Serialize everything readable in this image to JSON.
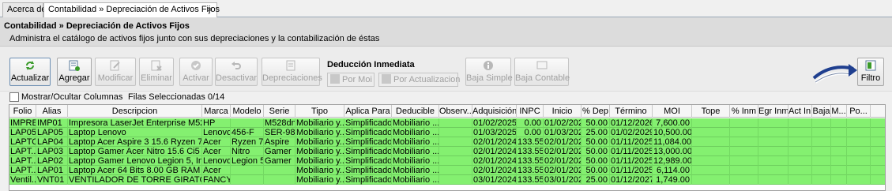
{
  "tabs": [
    {
      "label": "Acerca de"
    },
    {
      "label": "Contabilidad » Depreciación de Activos Fijos",
      "close": "×"
    }
  ],
  "header": {
    "title": "Contabilidad » Depreciación de Activos Fijos",
    "description": "Administra el catálogo de activos fijos junto con sus depreciaciones y la contabilización de éstas"
  },
  "toolbar": {
    "actualizar": "Actualizar",
    "agregar": "Agregar",
    "modificar": "Modificar",
    "eliminar": "Eliminar",
    "activar": "Activar",
    "desactivar": "Desactivar",
    "depreciaciones": "Depreciaciones",
    "deduccion_label": "Deducción Inmediata",
    "por_moi": "Por Moi",
    "por_actualizacion": "Por Actualizacion",
    "baja_simple": "Baja Simple",
    "baja_contable": "Baja Contable",
    "filtro": "Filtro"
  },
  "options": {
    "show_hide_columns": "Mostrar/Ocultar Columnas",
    "selected_rows": "Filas Seleccionadas  0/14"
  },
  "table": {
    "columns": [
      "Folio",
      "Alias",
      "Descripcion",
      "Marca",
      "Modelo",
      "Serie",
      "Tipo",
      "Aplica Para",
      "Deducible",
      "Observ...",
      "Adquisición",
      "INPC",
      "Inicio",
      "% Dep",
      "Término",
      "MOI",
      "Tope",
      "% Inm",
      "Egr Inm",
      "Act In...",
      "Baja",
      "M...",
      "Po..."
    ],
    "rows": [
      [
        "IMPRE...",
        "IMP01",
        "Impresora LaserJet Enterprise M528dn",
        "HP",
        "",
        "M528dn",
        "Mobiliario y...",
        "Simplificado...",
        "Mobiliario ...",
        "",
        "01/02/2025",
        "0.00",
        "01/02/2025",
        "50.00",
        "01/12/2026",
        "7,600.00",
        "",
        "",
        "",
        "",
        "",
        "",
        ""
      ],
      [
        "LAP05",
        "LAP05",
        "Laptop Lenovo",
        "Lenovo",
        "456-F",
        "SER-987",
        "Mobiliario y...",
        "Simplificado...",
        "Mobiliario ...",
        "",
        "01/03/2025",
        "0.00",
        "01/03/2025",
        "25.00",
        "01/02/2029",
        "10,500.00",
        "",
        "",
        "",
        "",
        "",
        "",
        ""
      ],
      [
        "LAPTOP",
        "LAP04",
        "Laptop Acer Aspire 3 15.6 Ryzen 7, 1...",
        "Acer",
        "Ryzen 7",
        "Aspire",
        "Mobiliario y...",
        "Simplificado...",
        "Mobiliario ...",
        "",
        "02/01/2024",
        "133.555",
        "02/01/2024",
        "50.00",
        "01/11/2025",
        "11,084.00",
        "",
        "",
        "",
        "",
        "",
        "",
        ""
      ],
      [
        "LAPT...",
        "LAP03",
        "Laptop Gamer Acer Nitro 15.6 Ci5 8g...",
        "Acer",
        "Nitro",
        "Gamer",
        "Mobiliario y...",
        "Simplificado...",
        "Mobiliario ...",
        "",
        "02/01/2024",
        "133.555",
        "02/01/2024",
        "50.00",
        "01/11/2025",
        "13,000.00",
        "",
        "",
        "",
        "",
        "",
        "",
        ""
      ],
      [
        "LAPT...",
        "LAP02",
        "Laptop Gamer Lenovo Legion 5, Inte...",
        "Lenovo",
        "Legion 5",
        "Gamer",
        "Mobiliario y...",
        "Simplificado...",
        "Mobiliario ...",
        "",
        "02/01/2024",
        "133.555",
        "02/01/2024",
        "50.00",
        "01/11/2025",
        "12,989.00",
        "",
        "",
        "",
        "",
        "",
        "",
        ""
      ],
      [
        "LAPT...",
        "LAP01",
        "Laptop Acer 64 Bits 8.00 GB RAM",
        "Acer",
        "",
        "",
        "Mobiliario y...",
        "Simplificado...",
        "Mobiliario ...",
        "",
        "02/01/2024",
        "133.555",
        "02/01/2024",
        "50.00",
        "01/11/2025",
        "6,114.00",
        "",
        "",
        "",
        "",
        "",
        "",
        ""
      ],
      [
        "Ventil...",
        "VNT01",
        "VENTILADOR DE TORRE GIRATORIO",
        "FANCY",
        "",
        "",
        "Mobiliario y...",
        "Simplificado...",
        "Mobiliario ...",
        "",
        "03/01/2024",
        "133.555",
        "03/01/2024",
        "25.00",
        "01/12/2027",
        "1,749.00",
        "",
        "",
        "",
        "",
        "",
        "",
        ""
      ]
    ]
  },
  "colors": {
    "row_bg": "#84f070",
    "header_bg": "#dcdcdc",
    "arrow": "#1f3f8f"
  },
  "icons": [
    "refresh-icon",
    "add-icon",
    "edit-icon",
    "delete-icon",
    "activate-icon",
    "undo-icon",
    "depreciation-icon",
    "moi-icon",
    "update-icon",
    "info-icon",
    "baja-contable-icon",
    "filter-icon",
    "arrow-icon"
  ]
}
